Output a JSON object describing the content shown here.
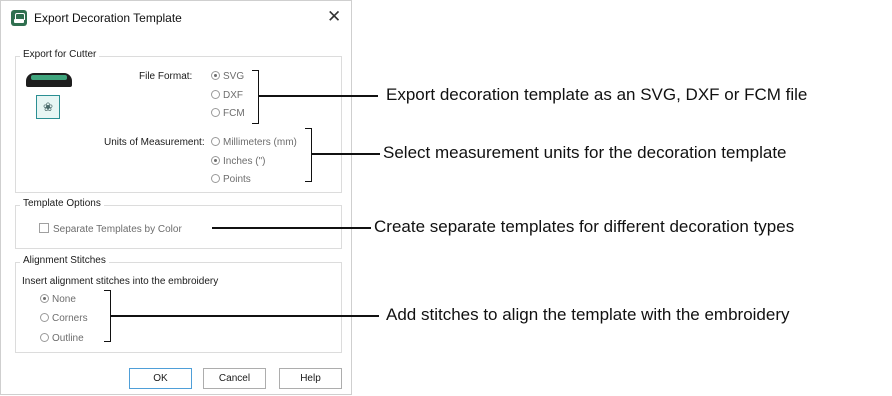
{
  "dialog": {
    "title": "Export Decoration Template",
    "close_glyph": "✕",
    "icon": "app-icon"
  },
  "export_for_cutter": {
    "legend": "Export for Cutter",
    "file_format_label": "File Format:",
    "file_format_options": [
      "SVG",
      "DXF",
      "FCM"
    ],
    "file_format_selected": "SVG",
    "units_label": "Units of Measurement:",
    "units_options": [
      "Millimeters (mm)",
      "Inches (\")",
      "Points"
    ],
    "units_selected": "Inches (\")",
    "illustration": "cutter-icon",
    "mat_glyph": "❀"
  },
  "template_options": {
    "legend": "Template Options",
    "separate_by_color_label": "Separate Templates by Color",
    "separate_by_color_checked": false
  },
  "alignment_stitches": {
    "legend": "Alignment Stitches",
    "description": "Insert alignment stitches into the embroidery",
    "options": [
      "None",
      "Corners",
      "Outline"
    ],
    "selected": "None"
  },
  "buttons": {
    "ok": "OK",
    "cancel": "Cancel",
    "help": "Help"
  },
  "callouts": {
    "file_format": "Export decoration template as an SVG, DXF or FCM file",
    "units": "Select measurement units for the decoration template",
    "separate": "Create separate templates for different decoration types",
    "alignment": "Add stitches to align the template with the embroidery"
  },
  "colors": {
    "accent": "#4f9fd8",
    "app_icon": "#2f6f4f",
    "cutter_slot": "#3fa47c",
    "mat_border": "#2b8f93"
  }
}
